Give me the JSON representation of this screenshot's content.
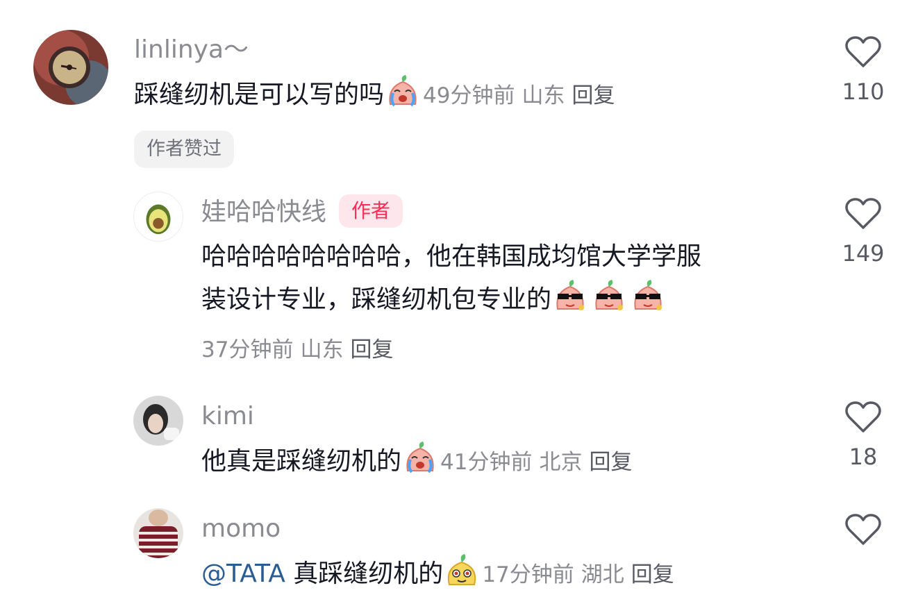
{
  "comments": [
    {
      "username": "linlinya～",
      "text": "踩缝纫机是可以写的吗",
      "emoji": "crying-emoji",
      "time": "49分钟前",
      "location": "山东",
      "reply_label": "回复",
      "likes": "110",
      "liked_badge": "作者赞过"
    },
    {
      "username": "娃哈哈快线",
      "author_tag": "作者",
      "text_line1": "哈哈哈哈哈哈哈哈，他在韩国成均馆大学学服",
      "text_line2": "装设计专业，踩缝纫机包专业的",
      "emoji": "cool-sunglasses-emoji",
      "time": "37分钟前",
      "location": "山东",
      "reply_label": "回复",
      "likes": "149"
    },
    {
      "username": "kimi",
      "text": "他真是踩缝纫机的",
      "emoji": "crying-emoji",
      "time": "41分钟前",
      "location": "北京",
      "reply_label": "回复",
      "likes": "18"
    },
    {
      "username": "momo",
      "mention": "@TATA",
      "text": " 真踩缝纫机的",
      "emoji": "smug-emoji",
      "time": "17分钟前",
      "location": "湖北",
      "reply_label": "回复"
    }
  ],
  "colors": {
    "text_primary": "#161823",
    "text_secondary": "#8a8b91",
    "mention": "#2b5d95",
    "author_tag": "#fe2c55"
  }
}
